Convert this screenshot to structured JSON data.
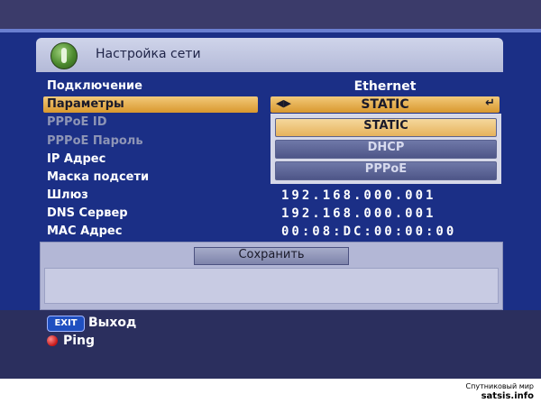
{
  "window": {
    "title": "Настройка сети"
  },
  "rows": [
    {
      "label": "Подключение",
      "state": "normal"
    },
    {
      "label": "Параметры",
      "state": "selected"
    },
    {
      "label": "PPPoE ID",
      "state": "disabled"
    },
    {
      "label": "PPPoE Пароль",
      "state": "disabled"
    },
    {
      "label": "IP Адрес",
      "state": "normal"
    },
    {
      "label": "Маска подсети",
      "state": "normal"
    },
    {
      "label": "Шлюз",
      "state": "normal"
    },
    {
      "label": "DNS Сервер",
      "state": "normal"
    },
    {
      "label": "MAC Адрес",
      "state": "normal"
    }
  ],
  "values": {
    "connection": "Ethernet",
    "params": "STATIC",
    "gateway": "192.168.000.001",
    "dns": "192.168.000.001",
    "mac": "00:08:DC:00:00:00"
  },
  "dropdown": {
    "options": [
      "STATIC",
      "DHCP",
      "PPPoE"
    ],
    "selected": "STATIC"
  },
  "buttons": {
    "save": "Сохранить"
  },
  "help": {
    "exit_key": "EXIT",
    "exit_label": "Выход",
    "ping_label": "Ping"
  },
  "watermark": {
    "line1": "Спутниковый мир",
    "line2": "satsis.info"
  },
  "colors": {
    "background": "#1b2f86",
    "selection": "#e6b25c",
    "panel": "#b3b7d6",
    "help_band": "#2b2f5e",
    "ping_red": "#c41414"
  }
}
